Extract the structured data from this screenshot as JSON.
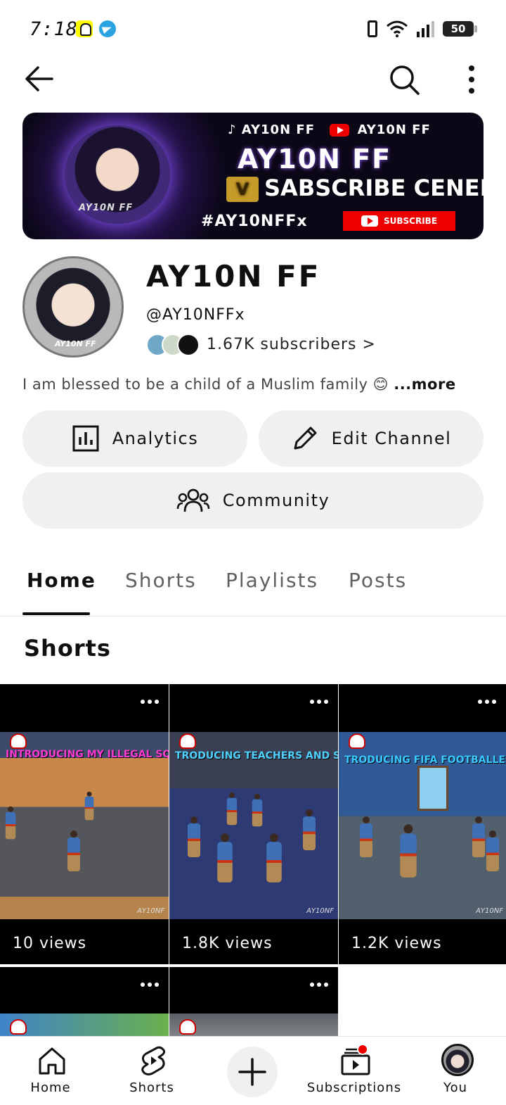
{
  "status_bar": {
    "time": "7:18",
    "battery": "50"
  },
  "banner": {
    "top_line_tiktok": "AY10N FF",
    "top_line_youtube": "AY10N FF",
    "title": "AY10N FF",
    "subscribe_text": "SABSCRIBE CENEL",
    "v_badge": "V",
    "hashtag": "#AY10NFFx",
    "subscribe_button": "SUBSCRIBE",
    "avatar_tag": "AY10N FF"
  },
  "channel": {
    "name": "AY10N FF",
    "handle": "@AY10NFFx",
    "subscribers": "1.67K subscribers >",
    "description": "I am blessed to be a child of a Muslim family 😊",
    "more": "...more",
    "avatar_tag": "AY10N FF"
  },
  "actions": {
    "analytics": "Analytics",
    "edit_channel": "Edit Channel",
    "community": "Community"
  },
  "tabs": [
    {
      "label": "Home",
      "active": true
    },
    {
      "label": "Shorts",
      "active": false
    },
    {
      "label": "Playlists",
      "active": false
    },
    {
      "label": "Posts",
      "active": false
    }
  ],
  "section_title": "Shorts",
  "shorts": [
    {
      "caption": "INTRODUCING MY ILLEGAL SQUAD",
      "views": "10 views",
      "watermark": "AY10NF"
    },
    {
      "caption": "TRODUCING TEACHERS AND STUDENTS",
      "views": "1.8K views",
      "watermark": "AY10NF"
    },
    {
      "caption": "TRODUCING FIFA FOOTBALLERS",
      "views": "1.2K views",
      "watermark": "AY10NF"
    }
  ],
  "bottom_nav": {
    "home": "Home",
    "shorts": "Shorts",
    "subscriptions": "Subscriptions",
    "you": "You"
  },
  "colors": {
    "accent_red": "#ff0000",
    "pill_bg": "#f0f0f0",
    "text": "#0f0f0f"
  }
}
